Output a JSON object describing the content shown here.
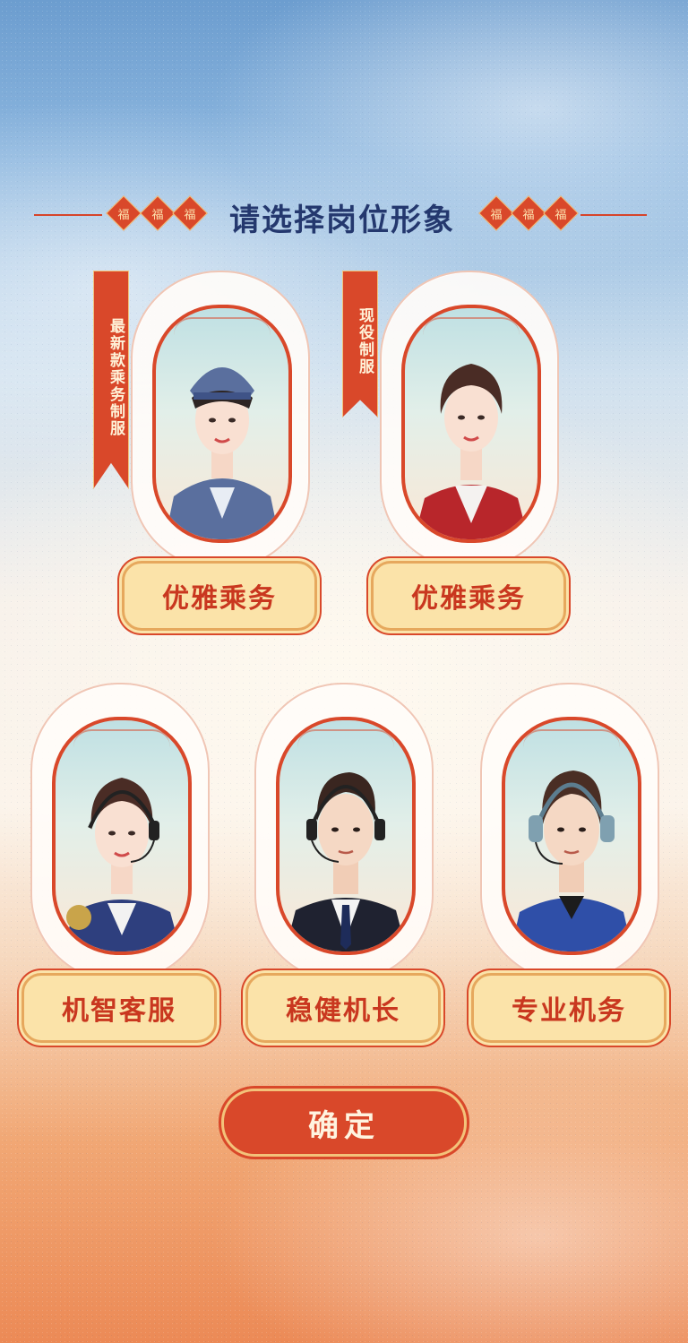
{
  "title": "请选择岗位形象",
  "fu_char": "福",
  "colors": {
    "accent_red": "#d9482a",
    "title_blue": "#24386e",
    "label_bg": "#fbe3a9",
    "label_text": "#c9371f"
  },
  "cards": [
    {
      "label": "优雅乘务",
      "ribbon": "最新款乘务制服",
      "portrait": "female-flight-attendant-blue-uniform"
    },
    {
      "label": "优雅乘务",
      "ribbon": "现役制服",
      "portrait": "female-flight-attendant-red-vest"
    },
    {
      "label": "机智客服",
      "portrait": "female-customer-service-headset"
    },
    {
      "label": "稳健机长",
      "portrait": "male-captain-headset"
    },
    {
      "label": "专业机务",
      "portrait": "male-mechanic-headset"
    }
  ],
  "confirm_label": "确定"
}
